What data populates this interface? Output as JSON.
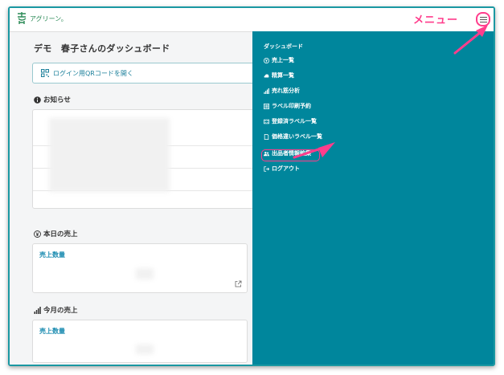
{
  "header": {
    "logo_text": "アグリーン。"
  },
  "main": {
    "title": "デモ　春子さんのダッシュボード",
    "qr_button_label": "ログイン用QRコードを開く",
    "news_heading": "お知らせ",
    "today_heading": "本日の売上",
    "today_card_label": "売上数量",
    "month_heading": "今月の売上",
    "month_card_label": "売上数量"
  },
  "side_menu": {
    "title": "ダッシュボード",
    "items": [
      {
        "label": "売上一覧",
        "icon": "yen-circle-icon"
      },
      {
        "label": "精算一覧",
        "icon": "cloud-icon"
      },
      {
        "label": "売れ筋分析",
        "icon": "bar-chart-icon"
      },
      {
        "label": "ラベル印刷予約",
        "icon": "barcode-icon"
      },
      {
        "label": "登録済ラベル一覧",
        "icon": "id-card-icon"
      },
      {
        "label": "価格違いラベル一覧",
        "icon": "document-icon"
      },
      {
        "label": "出品者情報編集",
        "icon": "users-icon"
      },
      {
        "label": "ログアウト",
        "icon": "logout-icon"
      }
    ]
  },
  "annotation": {
    "menu_callout": "メニュー",
    "accent_color": "#ff3d8c"
  },
  "colors": {
    "panel_bg": "#00869c",
    "frame": "#1a98a2",
    "link": "#1a8bb0"
  }
}
